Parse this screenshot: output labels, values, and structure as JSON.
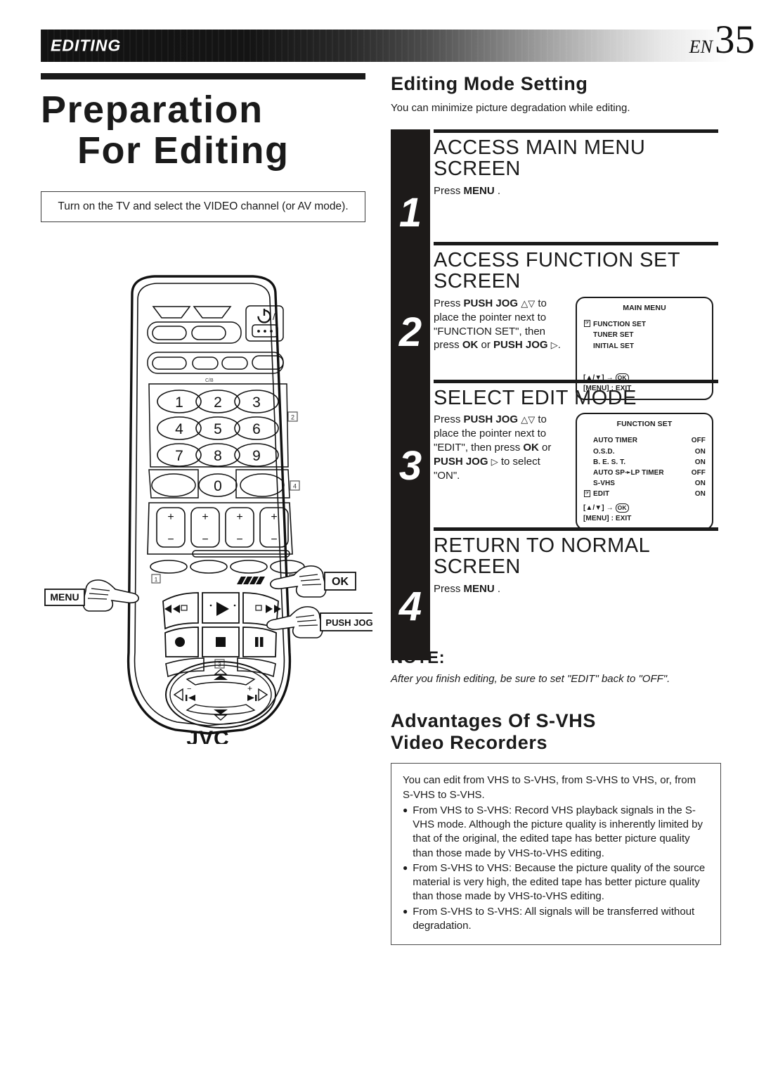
{
  "header": {
    "chapter": "EDITING",
    "lang": "EN",
    "page_number": "35"
  },
  "left": {
    "title_line1": "Preparation",
    "title_line2": "For Editing",
    "prep_note": "Turn on the TV and select the VIDEO channel (or AV mode).",
    "remote": {
      "brand": "JVC",
      "power_icon": "power-standby-icon",
      "keypad": [
        "1",
        "2",
        "3",
        "4",
        "5",
        "6",
        "7",
        "8",
        "9",
        "0"
      ],
      "transport_icons": [
        "rewind-icon",
        "play-icon",
        "fast-forward-icon",
        "record-icon",
        "stop-icon",
        "pause-icon"
      ],
      "plus": "+",
      "minus": "−",
      "callouts": [
        {
          "label": "MENU",
          "side": "left"
        },
        {
          "label": "OK",
          "side": "right"
        },
        {
          "label": "PUSH JOG",
          "side": "right"
        }
      ],
      "ref_marks": [
        "2",
        "4",
        "1",
        "3"
      ]
    }
  },
  "right": {
    "section_title": "Editing Mode Setting",
    "section_sub": "You can minimize picture degradation while editing.",
    "steps": [
      {
        "number": "1",
        "heading": "ACCESS MAIN MENU SCREEN",
        "text_plain": "Press MENU .",
        "text_pre": "Press ",
        "text_bold": "MENU",
        "text_post": " ."
      },
      {
        "number": "2",
        "heading": "ACCESS FUNCTION SET SCREEN",
        "text": "Press PUSH JOG △▽ to place the pointer next to \"FUNCTION SET\", then press OK or PUSH JOG ▷ ."
      },
      {
        "number": "3",
        "heading": "SELECT EDIT MODE",
        "text": "Press PUSH JOG △▽ to place the pointer next to \"EDIT\", then press OK or PUSH JOG ▷ to select \"ON\"."
      },
      {
        "number": "4",
        "heading": "RETURN TO NORMAL SCREEN",
        "text_pre": "Press ",
        "text_bold": "MENU",
        "text_post": " ."
      }
    ],
    "osd_main_menu": {
      "title": "MAIN MENU",
      "items": [
        "FUNCTION SET",
        "TUNER SET",
        "INITIAL SET"
      ],
      "pointer_on": "FUNCTION SET",
      "footer_nav": "[▲/▼] →",
      "footer_ok": "OK",
      "footer_exit": "[MENU] : EXIT"
    },
    "osd_function_set": {
      "title": "FUNCTION SET",
      "rows": [
        {
          "label": "AUTO TIMER",
          "value": "OFF"
        },
        {
          "label": "O.S.D.",
          "value": "ON"
        },
        {
          "label": "B. E. S. T.",
          "value": "ON"
        },
        {
          "label": "AUTO SP➛LP TIMER",
          "value": "OFF"
        },
        {
          "label": "S-VHS",
          "value": "ON"
        },
        {
          "label": "EDIT",
          "value": "ON"
        }
      ],
      "pointer_on": "EDIT",
      "footer_nav": "[▲/▼] →",
      "footer_ok": "OK",
      "footer_exit": "[MENU] : EXIT"
    },
    "note": {
      "title": "NOTE:",
      "text": "After you finish editing, be sure to set \"EDIT\" back to \"OFF\"."
    },
    "advantages": {
      "title_line1": "Advantages Of S-VHS",
      "title_line2": "Video Recorders",
      "intro": "You can edit from VHS to S-VHS, from S-VHS to VHS, or, from S-VHS to S-VHS.",
      "bullets": [
        "From VHS to S-VHS: Record VHS playback signals in the S-VHS mode. Although the picture quality is inherently limited by that of the original, the edited tape has better picture quality than those made by VHS-to-VHS editing.",
        "From S-VHS to VHS: Because the picture quality of the source material is very high, the edited tape has better picture quality than those made by VHS-to-VHS editing.",
        "From S-VHS to S-VHS: All signals will be transferred without degradation."
      ],
      "bullet_glyph": "●"
    }
  }
}
